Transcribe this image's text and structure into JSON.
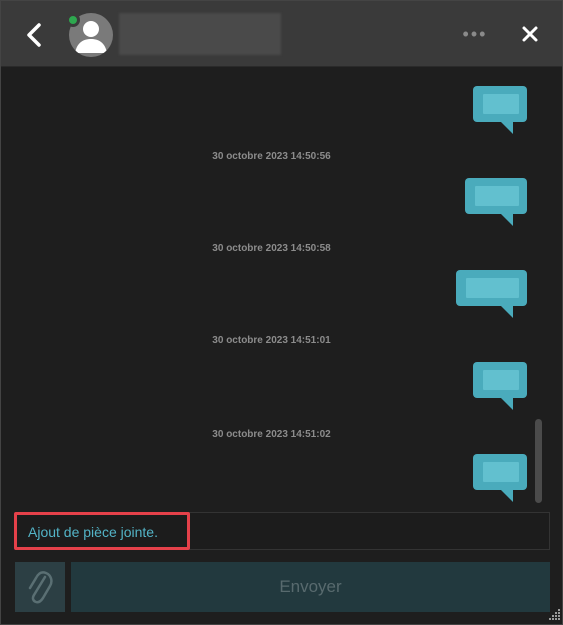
{
  "header": {
    "contact_name": "",
    "presence_status": "online",
    "icons": {
      "back": "chevron-left-icon",
      "more": "more-options-icon",
      "close": "close-icon",
      "avatar": "user-avatar-icon"
    },
    "more_label": "•••"
  },
  "messages": [
    {
      "text": "",
      "direction": "outgoing"
    },
    {
      "timestamp": "30 octobre 2023 14:50:56"
    },
    {
      "text": "",
      "direction": "outgoing"
    },
    {
      "timestamp": "30 octobre 2023 14:50:58"
    },
    {
      "text": "",
      "direction": "outgoing"
    },
    {
      "timestamp": "30 octobre 2023 14:51:01"
    },
    {
      "text": "",
      "direction": "outgoing"
    },
    {
      "timestamp": "30 octobre 2023 14:51:02"
    },
    {
      "text": "",
      "direction": "outgoing"
    }
  ],
  "timestamps": [
    "30 octobre 2023 14:50:56",
    "30 octobre 2023 14:50:58",
    "30 octobre 2023 14:51:01",
    "30 octobre 2023 14:51:02"
  ],
  "composer": {
    "input_value": "Ajout de pièce jointe.",
    "attach_icon": "paperclip-icon",
    "send_label": "Envoyer"
  },
  "colors": {
    "accent": "#4aabbc",
    "background": "#1e1e1e",
    "header": "#3a3a3a",
    "presence": "#2ea84f",
    "highlight": "#e5414a"
  }
}
